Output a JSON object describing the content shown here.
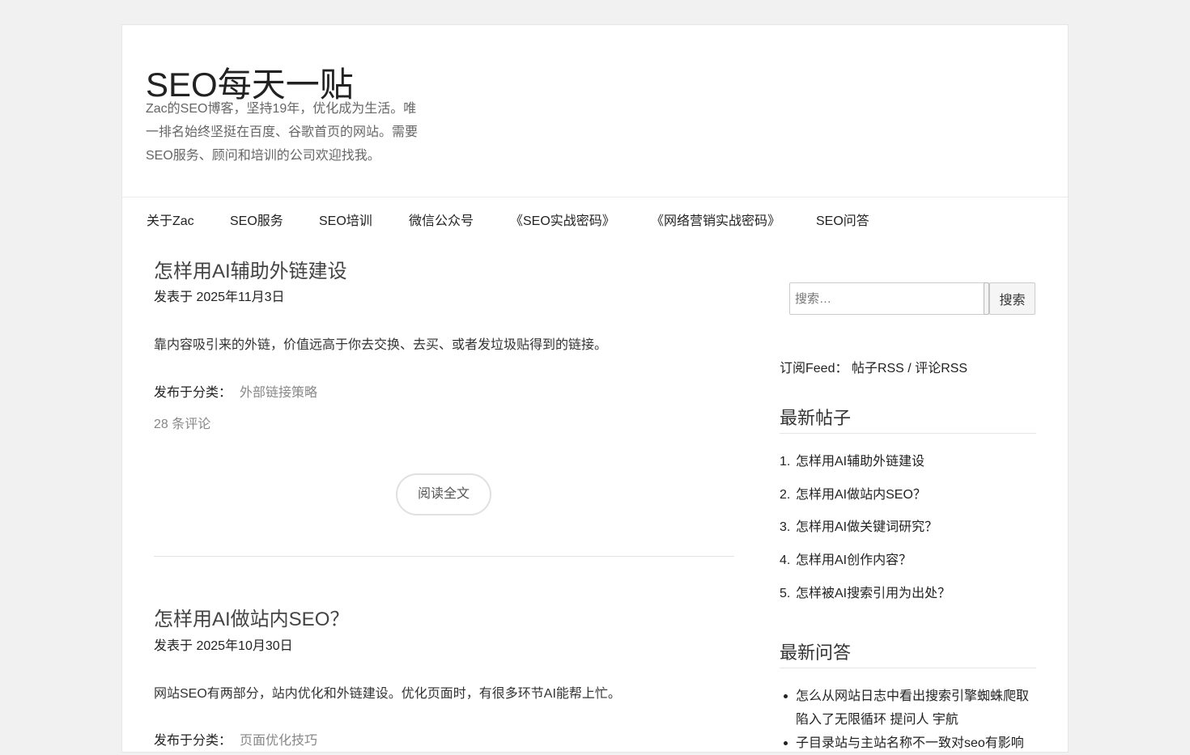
{
  "site": {
    "title": "SEO每天一贴",
    "description": "Zac的SEO博客，坚持19年，优化成为生活。唯一排名始终坚挺在百度、谷歌首页的网站。需要SEO服务、顾问和培训的公司欢迎找我。"
  },
  "nav": {
    "items": [
      {
        "label": "关于Zac"
      },
      {
        "label": "SEO服务"
      },
      {
        "label": "SEO培训"
      },
      {
        "label": "微信公众号"
      },
      {
        "label": "《SEO实战密码》"
      },
      {
        "label": "《网络营销实战密码》"
      },
      {
        "label": "SEO问答"
      }
    ]
  },
  "posts": [
    {
      "title": "怎样用AI辅助外链建设",
      "date": "发表于 2025年11月3日",
      "excerpt": "靠内容吸引来的外链，价值远高于你去交换、去买、或者发垃圾贴得到的链接。",
      "category_label": "发布于分类：",
      "category": "外部链接策略",
      "comments": "28 条评论",
      "read_more": "阅读全文"
    },
    {
      "title": "怎样用AI做站内SEO？",
      "date": "发表于 2025年10月30日",
      "excerpt": "网站SEO有两部分，站内优化和外链建设。优化页面时，有很多环节AI能帮上忙。",
      "category_label": "发布于分类：",
      "category": "页面优化技巧"
    }
  ],
  "sidebar": {
    "search": {
      "placeholder": "搜索…",
      "button": "搜索"
    },
    "feed": {
      "label": "订阅Feed：",
      "posts_rss": "帖子RSS",
      "separator": "/",
      "comments_rss": "评论RSS"
    },
    "recent_posts": {
      "title": "最新帖子",
      "items": [
        "怎样用AI辅助外链建设",
        "怎样用AI做站内SEO？",
        "怎样用AI做关键词研究？",
        "怎样用AI创作内容？",
        "怎样被AI搜索引用为出处？"
      ]
    },
    "recent_qa": {
      "title": "最新问答",
      "items": [
        "怎么从网站日志中看出搜索引擎蜘蛛爬取陷入了无限循环 提问人 宇航",
        "子目录站与主站名称不一致对seo有影响"
      ]
    }
  }
}
